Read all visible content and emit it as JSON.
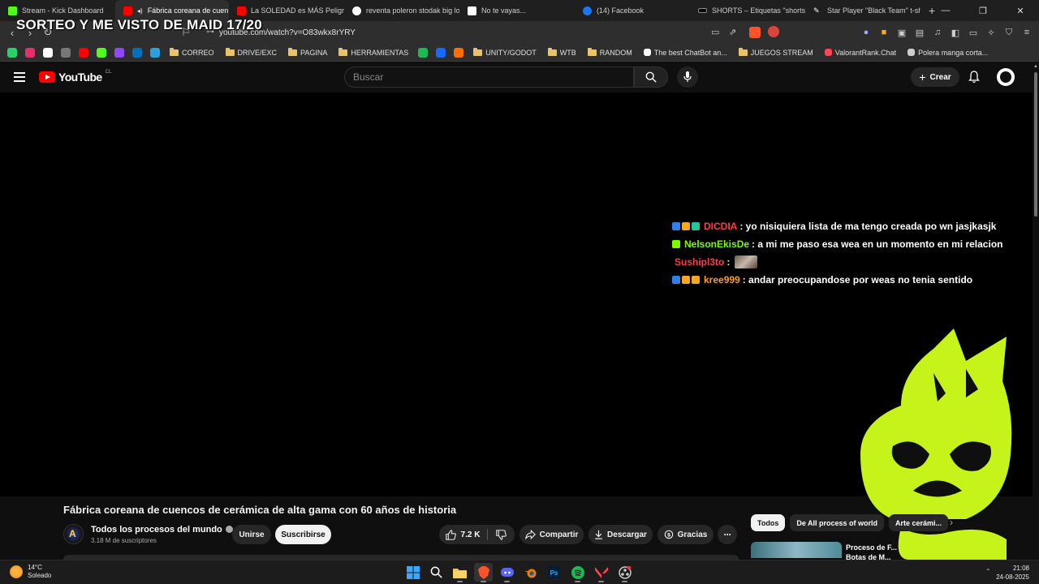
{
  "overlay": {
    "stream_title": "SORTEO Y ME VISTO DE MAID 17/20"
  },
  "browser": {
    "tabs": [
      {
        "label": "Stream - Kick Dashboard",
        "color": "#53fc18"
      },
      {
        "label": "Fábrica coreana de cuen",
        "color": "#ff0000",
        "active": true
      },
      {
        "label": "La SOLEDAD es MÁS Peligrosa",
        "color": "#ff0000"
      },
      {
        "label": "reventa poleron stodak big log",
        "color": "#4285f4"
      },
      {
        "label": "No te vayas...",
        "color": "#ffffff"
      },
      {
        "label": "(14) Facebook",
        "color": "#1877f2"
      },
      {
        "label": "SHORTS – Etiquetas \"shorts\" –",
        "color": "#000000"
      },
      {
        "label": "Star Player \"Black Team\" t-shirt",
        "color": "#ffffff"
      }
    ],
    "url": "youtube.com/watch?v=O83wkx8rYRY",
    "bookmarks": [
      {
        "label": "",
        "type": "icon",
        "color": "#25d366"
      },
      {
        "label": "",
        "type": "icon",
        "color": "#e1306c"
      },
      {
        "label": "",
        "type": "icon",
        "color": "#ffffff"
      },
      {
        "label": "",
        "type": "icon",
        "color": "#777777"
      },
      {
        "label": "",
        "type": "icon",
        "color": "#ff0000"
      },
      {
        "label": "",
        "type": "icon",
        "color": "#53fc18"
      },
      {
        "label": "",
        "type": "icon",
        "color": "#9146ff"
      },
      {
        "label": "",
        "type": "icon",
        "color": "#0070ba"
      },
      {
        "label": "",
        "type": "icon",
        "color": "#2aa1da"
      },
      {
        "label": "CORREO",
        "type": "folder"
      },
      {
        "label": "DRIVE/EXC",
        "type": "folder"
      },
      {
        "label": "PAGINA",
        "type": "folder"
      },
      {
        "label": "HERRAMIENTAS",
        "type": "folder"
      },
      {
        "label": "",
        "type": "icon",
        "color": "#1db954"
      },
      {
        "label": "",
        "type": "icon",
        "color": "#1769ff"
      },
      {
        "label": "",
        "type": "icon",
        "color": "#ff6d00"
      },
      {
        "label": "UNITY/GODOT",
        "type": "folder"
      },
      {
        "label": "WTB",
        "type": "folder"
      },
      {
        "label": "RANDOM",
        "type": "folder"
      },
      {
        "label": "The best ChatBot an...",
        "type": "link",
        "color": "#ffffff"
      },
      {
        "label": "JUEGOS STREAM",
        "type": "folder"
      },
      {
        "label": "ValorantRank.Chat",
        "type": "link",
        "color": "#ff4655"
      },
      {
        "label": "Polera manga corta...",
        "type": "link",
        "color": "#cccccc"
      }
    ]
  },
  "youtube": {
    "country_code": "CL",
    "search_placeholder": "Buscar",
    "create_label": "Crear",
    "video_title": "Fábrica coreana de cuencos de cerámica de alta gama con 60 años de historia",
    "channel_name": "Todos los procesos del mundo",
    "subscribers": "3.18 M de suscriptores",
    "join_label": "Unirse",
    "subscribe_label": "Suscribirse",
    "likes": "7.2 K",
    "share_label": "Compartir",
    "download_label": "Descargar",
    "thanks_label": "Gracias",
    "chips": [
      "Todos",
      "De All process of world",
      "Arte cerámi..."
    ],
    "rec_title": "Proceso de F... Botas de M..."
  },
  "chat": [
    {
      "user": "DICDIA",
      "color": "#ff3b4a",
      "message": ": yo nisiquiera lista de ma tengo creada po wn jasjkasjk",
      "badges": [
        "#2f80ed",
        "#f5a623",
        "#20c997"
      ]
    },
    {
      "user": "NelsonEkisDe",
      "color": "#7cfc00",
      "message": ": a mi me paso esa wea en un momento en mi relacion",
      "badges": [
        "#7cfc00"
      ]
    },
    {
      "user": "Sushipl3to",
      "color": "#ff3b4a",
      "message": ":",
      "badges": [],
      "emote": true
    },
    {
      "user": "kree999",
      "color": "#ff9f1a",
      "message": ": andar preocupandose por weas no tenia sentido",
      "badges": [
        "#2f80ed",
        "#f5a623",
        "#f5a623"
      ]
    }
  ],
  "taskbar": {
    "temperature": "14°C",
    "condition": "Soleado",
    "time": "21:08",
    "date": "24-08-2025",
    "apps": [
      "windows-start",
      "search",
      "file-explorer",
      "brave",
      "discord",
      "blender",
      "photoshop",
      "spotify",
      "valorant",
      "obs"
    ]
  },
  "colors": {
    "mascot": "#c6f31a",
    "youtube_red": "#ff0000",
    "brave": "#fb542b"
  }
}
